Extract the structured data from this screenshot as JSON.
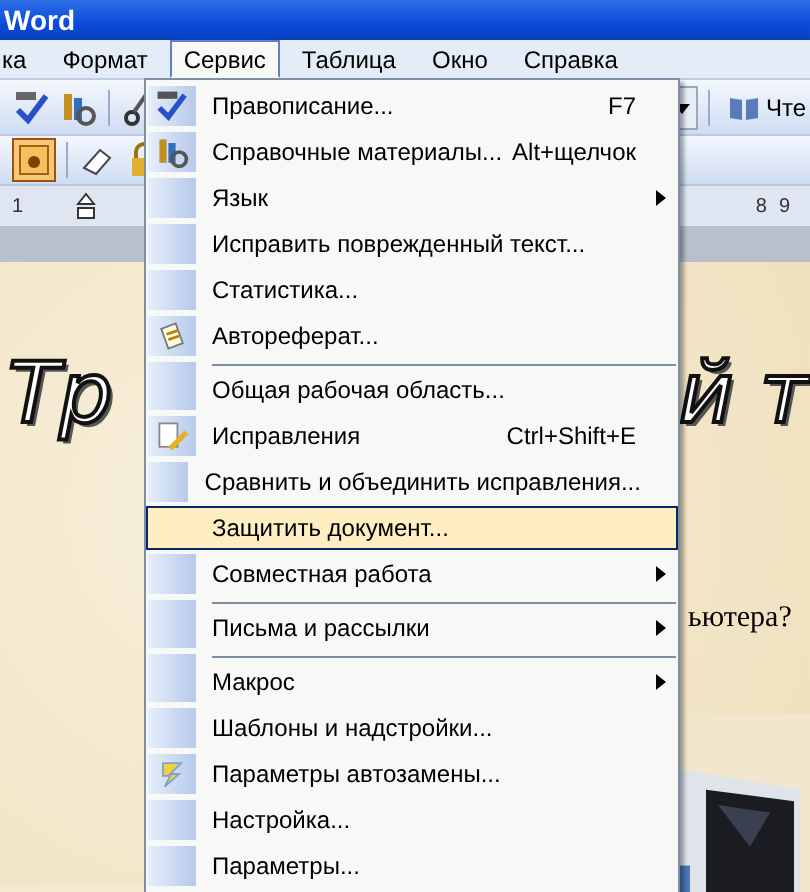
{
  "window": {
    "title": "Word"
  },
  "menubar": [
    {
      "label": "ка",
      "selected": false
    },
    {
      "label": "Формат",
      "selected": false
    },
    {
      "label": "Сервис",
      "selected": true
    },
    {
      "label": "Таблица",
      "selected": false
    },
    {
      "label": "Окно",
      "selected": false
    },
    {
      "label": "Справка",
      "selected": false
    }
  ],
  "toolbar": {
    "reading_button": "Чте"
  },
  "ruler": {
    "labels": [
      "1",
      "8",
      "9"
    ]
  },
  "document": {
    "heading_fragments": [
      "Тр",
      "й т"
    ],
    "text_fragment": "ьютера?",
    "picture": {
      "kind": "picture"
    }
  },
  "menu": [
    {
      "label": "Правописание...",
      "shortcut": "F7",
      "kind": "spelling",
      "submenu": false,
      "separator_before": false,
      "selected": false
    },
    {
      "label": "Справочные материалы...",
      "shortcut": "Alt+щелчок",
      "kind": "research",
      "submenu": false,
      "separator_before": false,
      "selected": false
    },
    {
      "label": "Язык",
      "kind": "plain",
      "submenu": true,
      "separator_before": false,
      "selected": false
    },
    {
      "label": "Исправить поврежденный текст...",
      "kind": "plain",
      "submenu": false,
      "separator_before": false,
      "selected": false
    },
    {
      "label": "Статистика...",
      "kind": "plain",
      "submenu": false,
      "separator_before": false,
      "selected": false
    },
    {
      "label": "Автореферат...",
      "kind": "summary",
      "submenu": false,
      "separator_before": false,
      "selected": false
    },
    {
      "label": "Общая рабочая область...",
      "kind": "plain",
      "submenu": false,
      "separator_before": true,
      "selected": false
    },
    {
      "label": "Исправления",
      "shortcut": "Ctrl+Shift+E",
      "kind": "track",
      "submenu": false,
      "separator_before": false,
      "selected": false
    },
    {
      "label": "Сравнить и объединить исправления...",
      "kind": "plain",
      "submenu": false,
      "separator_before": false,
      "selected": false
    },
    {
      "label": "Защитить документ...",
      "kind": "plain",
      "submenu": false,
      "separator_before": false,
      "selected": true
    },
    {
      "label": "Совместная работа",
      "kind": "plain",
      "submenu": true,
      "separator_before": false,
      "selected": false
    },
    {
      "label": "Письма и рассылки",
      "kind": "plain",
      "submenu": true,
      "separator_before": true,
      "selected": false
    },
    {
      "label": "Макрос",
      "kind": "plain",
      "submenu": true,
      "separator_before": true,
      "selected": false
    },
    {
      "label": "Шаблоны и надстройки...",
      "kind": "plain",
      "submenu": false,
      "separator_before": false,
      "selected": false
    },
    {
      "label": "Параметры автозамены...",
      "kind": "autocorrect",
      "submenu": false,
      "separator_before": false,
      "selected": false
    },
    {
      "label": "Настройка...",
      "kind": "plain",
      "submenu": false,
      "separator_before": false,
      "selected": false
    },
    {
      "label": "Параметры...",
      "kind": "plain",
      "submenu": false,
      "separator_before": false,
      "selected": false
    }
  ]
}
